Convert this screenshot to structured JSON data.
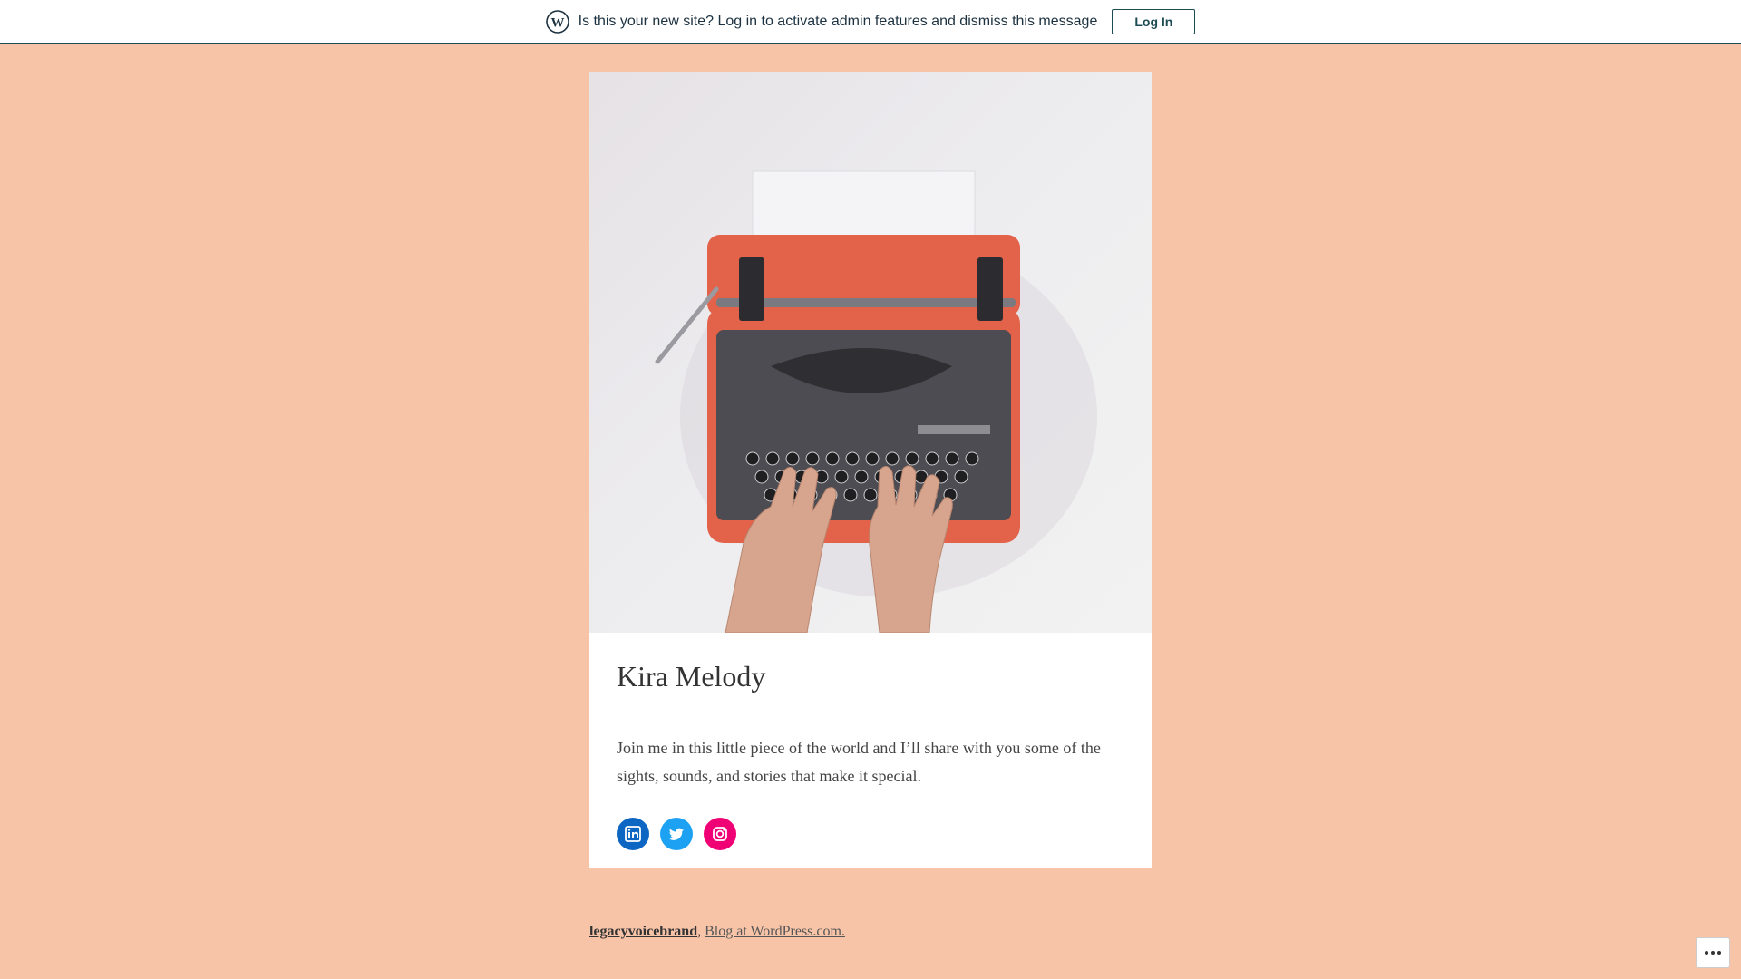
{
  "notice": {
    "message": "Is this your new site? Log in to activate admin features and dismiss this message",
    "login_label": "Log In"
  },
  "site": {
    "title": "Kira Melody",
    "description": "Join me in this little piece of the world and I’ll share with you some of the sights, sounds, and stories that make it special.",
    "hero_image": "typewriter-photo"
  },
  "social": [
    {
      "name": "linkedin-icon",
      "color": "#0d66c2"
    },
    {
      "name": "twitter-icon",
      "color": "#1da1f2"
    },
    {
      "name": "instagram-icon",
      "color": "#f00075"
    }
  ],
  "footer": {
    "brand": "legacyvoicebrand",
    "separator": ",",
    "wp_link": "Blog at WordPress.com."
  },
  "colors": {
    "background": "#f7c4a8",
    "card": "#ffffff",
    "accent": "#1d4b53"
  }
}
